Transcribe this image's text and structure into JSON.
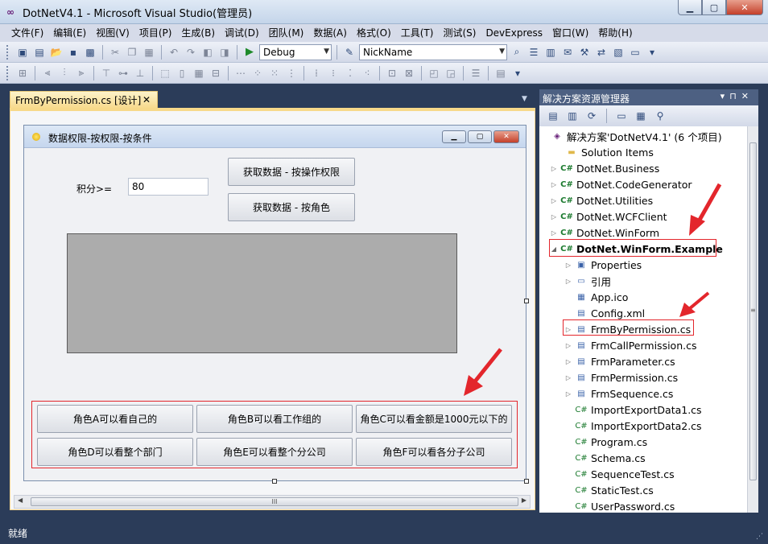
{
  "window": {
    "title": "DotNetV4.1 - Microsoft Visual Studio(管理员)"
  },
  "menu": [
    "文件(F)",
    "编辑(E)",
    "视图(V)",
    "项目(P)",
    "生成(B)",
    "调试(D)",
    "团队(M)",
    "数据(A)",
    "格式(O)",
    "工具(T)",
    "测试(S)",
    "DevExpress",
    "窗口(W)",
    "帮助(H)"
  ],
  "toolbar": {
    "config": "Debug",
    "find_combo": "NickName"
  },
  "document": {
    "tab_label": "FrmByPermission.cs [设计]",
    "tab_close": "✕"
  },
  "form": {
    "title": "数据权限-按权限-按条件",
    "score_label": "积分>=",
    "score_value": "80",
    "btn_by_operation": "获取数据 - 按操作权限",
    "btn_by_role": "获取数据 - 按角色",
    "role_buttons": [
      "角色A可以看自己的",
      "角色B可以看工作组的",
      "角色C可以看金额是1000元以下的",
      "角色D可以看整个部门",
      "角色E可以看整个分公司",
      "角色F可以看各分子公司"
    ]
  },
  "scroll": {
    "grip": "III"
  },
  "solution_explorer": {
    "title": "解决方案资源管理器",
    "items": [
      {
        "label": "解决方案'DotNetV4.1' (6 个项目)",
        "icon": "solution-icon"
      },
      {
        "label": "Solution Items",
        "icon": "folder-icon"
      },
      {
        "label": "DotNet.Business",
        "icon": "project-icon"
      },
      {
        "label": "DotNet.CodeGenerator",
        "icon": "project-icon"
      },
      {
        "label": "DotNet.Utilities",
        "icon": "project-icon"
      },
      {
        "label": "DotNet.WCFClient",
        "icon": "project-icon"
      },
      {
        "label": "DotNet.WinForm",
        "icon": "project-icon"
      },
      {
        "label": "DotNet.WinForm.Example",
        "icon": "project-icon"
      },
      {
        "label": "Properties",
        "icon": "properties-icon"
      },
      {
        "label": "引用",
        "icon": "references-icon"
      },
      {
        "label": "App.ico",
        "icon": "file-icon"
      },
      {
        "label": "Config.xml",
        "icon": "file-icon"
      },
      {
        "label": "FrmByPermission.cs",
        "icon": "form-icon"
      },
      {
        "label": "FrmCallPermission.cs",
        "icon": "form-icon"
      },
      {
        "label": "FrmParameter.cs",
        "icon": "form-icon"
      },
      {
        "label": "FrmPermission.cs",
        "icon": "form-icon"
      },
      {
        "label": "FrmSequence.cs",
        "icon": "form-icon"
      },
      {
        "label": "ImportExportData1.cs",
        "icon": "cs-icon"
      },
      {
        "label": "ImportExportData2.cs",
        "icon": "cs-icon"
      },
      {
        "label": "Program.cs",
        "icon": "cs-icon"
      },
      {
        "label": "Schema.cs",
        "icon": "cs-icon"
      },
      {
        "label": "SequenceTest.cs",
        "icon": "cs-icon"
      },
      {
        "label": "StaticTest.cs",
        "icon": "cs-icon"
      },
      {
        "label": "UserPassword.cs",
        "icon": "cs-icon"
      }
    ]
  },
  "status": {
    "text": "就绪"
  },
  "colors": {
    "accent": "#e3262c",
    "chrome": "#2b3c59",
    "tab_active": "#f7d98a"
  }
}
